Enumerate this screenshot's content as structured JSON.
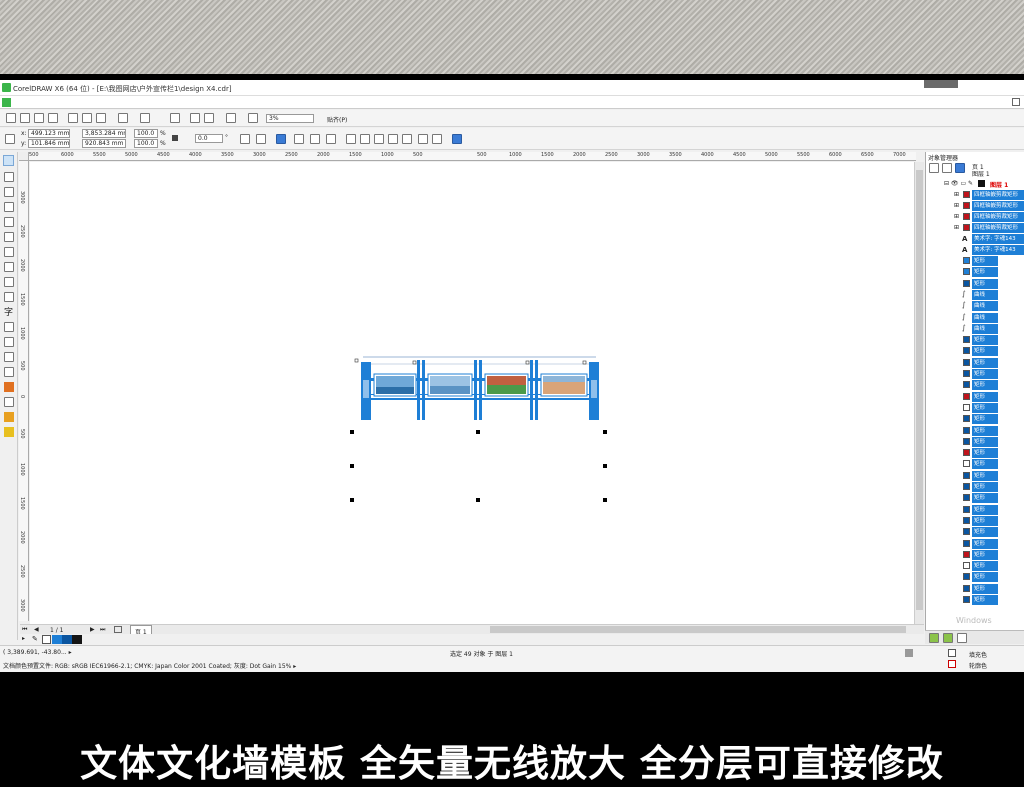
{
  "app": {
    "title": "CorelDRAW X6 (64 位) - [E:\\我图网店\\户外宣传栏1\\design X4.cdr]"
  },
  "toolbar": {
    "zoom_value": "3%",
    "snap_label": "贴齐(P)"
  },
  "property_bar": {
    "x_label": "x:",
    "x_value": "499.123 mm",
    "y_label": "y:",
    "y_value": "101.846 mm",
    "w_value": "3,853.284 mm",
    "h_value": "920.843 mm",
    "scale_w": "100.0",
    "scale_h": "100.0",
    "percent": "%",
    "angle_value": "0.0",
    "angle_unit": "°"
  },
  "ruler": {
    "h_ticks": [
      "500",
      "6000",
      "5500",
      "5000",
      "4500",
      "4000",
      "3500",
      "3000",
      "2500",
      "2000",
      "1500",
      "1000",
      "500",
      "",
      "500",
      "1000",
      "1500",
      "2000",
      "2500",
      "3000",
      "3500",
      "4000",
      "4500",
      "5000",
      "5500",
      "6000",
      "6500",
      "7000",
      "毫米"
    ],
    "v_ticks": [
      "3000",
      "2500",
      "2000",
      "1500",
      "1000",
      "500",
      "0",
      "500",
      "1000",
      "1500",
      "2000",
      "2500",
      "3000"
    ]
  },
  "object_manager": {
    "title": "对象管理器",
    "page_label": "页 1",
    "layer_label": "图层 1",
    "layer_active": "图层 1",
    "group_items": [
      "四框轴嵌剪裁矩形",
      "四框轴嵌剪裁矩形",
      "四框轴嵌剪裁矩形",
      "四框轴嵌剪裁矩形"
    ],
    "text_items": [
      "美术字: 字魂143",
      "美术字: 字魂143"
    ],
    "objects": [
      {
        "label": "矩形",
        "color": "#1e7fd6"
      },
      {
        "label": "矩形",
        "color": "#1e7fd6"
      },
      {
        "label": "矩形",
        "color": "#0a55a0"
      },
      {
        "label": "曲线",
        "color": "curve"
      },
      {
        "label": "曲线",
        "color": "curve"
      },
      {
        "label": "曲线",
        "color": "curve"
      },
      {
        "label": "曲线",
        "color": "curve"
      },
      {
        "label": "矩形",
        "color": "#0a55a0"
      },
      {
        "label": "矩形",
        "color": "#0a55a0"
      },
      {
        "label": "矩形",
        "color": "#0a55a0"
      },
      {
        "label": "矩形",
        "color": "#0a55a0"
      },
      {
        "label": "矩形",
        "color": "#0a55a0"
      },
      {
        "label": "矩形",
        "color": "#c0141c"
      },
      {
        "label": "矩形",
        "color": "#ffffff"
      },
      {
        "label": "矩形",
        "color": "#0a55a0"
      },
      {
        "label": "矩形",
        "color": "#0a55a0"
      },
      {
        "label": "矩形",
        "color": "#0a55a0"
      },
      {
        "label": "矩形",
        "color": "#c0141c"
      },
      {
        "label": "矩形",
        "color": "#ffffff"
      },
      {
        "label": "矩形",
        "color": "#0a55a0"
      },
      {
        "label": "矩形",
        "color": "#0a55a0"
      },
      {
        "label": "矩形",
        "color": "#0a55a0"
      },
      {
        "label": "矩形",
        "color": "#0a55a0"
      },
      {
        "label": "矩形",
        "color": "#0a55a0"
      },
      {
        "label": "矩形",
        "color": "#0a55a0"
      },
      {
        "label": "矩形",
        "color": "#0a55a0"
      },
      {
        "label": "矩形",
        "color": "#c0141c"
      },
      {
        "label": "矩形",
        "color": "#ffffff"
      },
      {
        "label": "矩形",
        "color": "#0a55a0"
      },
      {
        "label": "矩形",
        "color": "#0a55a0"
      },
      {
        "label": "矩形",
        "color": "#0a55a0"
      }
    ],
    "windows_text": "Windows"
  },
  "page_nav": {
    "page_count": "1 / 1",
    "page_tab": "页 1"
  },
  "status": {
    "coords": "( 3,389.691, -43.80... ▸",
    "selection": "选定 49 对象 于 图层 1",
    "color_profile": "文档颜色预置文件: RGB: sRGB IEC61966-2.1; CMYK: Japan Color 2001 Coated; 灰度: Dot Gain 15% ▸",
    "fill_label": "填充色",
    "outline_label": "轮廓色"
  },
  "palette": [
    "#1e7fd6",
    "#0a55a0",
    "#141414"
  ],
  "banner": {
    "text": "文体文化墙模板   全矢量无线放大 全分层可直接修改"
  },
  "colors": {
    "accent": "#1e7fd6",
    "dark_blue": "#0a55a0",
    "red": "#c0141c"
  }
}
